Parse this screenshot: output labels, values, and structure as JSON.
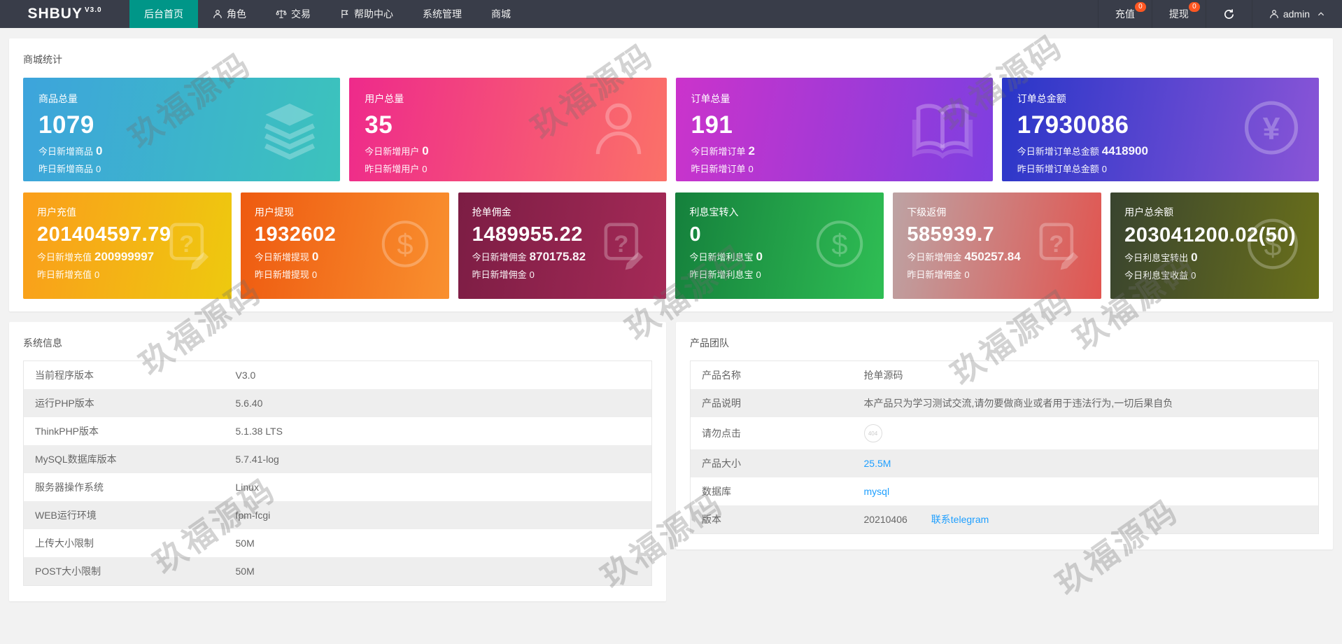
{
  "navbar": {
    "logo": "SHBUY",
    "version": "V3.0",
    "menu": [
      {
        "label": "后台首页",
        "active": true
      },
      {
        "label": "角色",
        "icon": "user-icon"
      },
      {
        "label": "交易",
        "icon": "scales-icon"
      },
      {
        "label": "帮助中心",
        "icon": "flag-icon"
      },
      {
        "label": "系统管理"
      },
      {
        "label": "商城"
      }
    ],
    "recharge": {
      "label": "充值",
      "badge": "0"
    },
    "withdraw": {
      "label": "提现",
      "badge": "0"
    },
    "user": {
      "name": "admin"
    }
  },
  "stats": {
    "title": "商城统计",
    "row1": [
      {
        "title": "商品总量",
        "value": "1079",
        "line1_label": "今日新增商品",
        "line1_value": "0",
        "line2_label": "昨日新增商品",
        "line2_value": "0",
        "icon": "layers-icon",
        "colors": [
          "#3da4dc",
          "#3cc3bc"
        ]
      },
      {
        "title": "用户总量",
        "value": "35",
        "line1_label": "今日新增用户",
        "line1_value": "0",
        "line2_label": "昨日新增用户",
        "line2_value": "0",
        "icon": "person-icon",
        "colors": [
          "#ee2a8b",
          "#fb7168"
        ]
      },
      {
        "title": "订单总量",
        "value": "191",
        "line1_label": "今日新增订单",
        "line1_value": "2",
        "line2_label": "昨日新增订单",
        "line2_value": "0",
        "icon": "book-icon",
        "colors": [
          "#cb33cb",
          "#7e3fe0"
        ]
      },
      {
        "title": "订单总金额",
        "value": "17930086",
        "line1_label": "今日新增订单总金额",
        "line1_value": "4418900",
        "line2_label": "昨日新增订单总金额",
        "line2_value": "0",
        "icon": "yen-circle-icon",
        "colors": [
          "#2936c8",
          "#8a55d7"
        ]
      }
    ],
    "row2": [
      {
        "title": "用户充值",
        "value": "201404597.79",
        "line1_label": "今日新增充值",
        "line1_value": "200999997",
        "line2_label": "昨日新增充值",
        "line2_value": "0",
        "icon": "edit-question-icon",
        "colors": [
          "#fa9e1b",
          "#eec90f"
        ]
      },
      {
        "title": "用户提现",
        "value": "1932602",
        "line1_label": "今日新增提现",
        "line1_value": "0",
        "line2_label": "昨日新增提现",
        "line2_value": "0",
        "icon": "dollar-circle-icon",
        "colors": [
          "#ee5a10",
          "#f9902f"
        ]
      },
      {
        "title": "抢单佣金",
        "value": "1489955.22",
        "line1_label": "今日新增佣金",
        "line1_value": "870175.82",
        "line2_label": "昨日新增佣金",
        "line2_value": "0",
        "icon": "edit-question-icon",
        "colors": [
          "#7c1d44",
          "#a52a57"
        ]
      },
      {
        "title": "利息宝转入",
        "value": "0",
        "line1_label": "今日新增利息宝",
        "line1_value": "0",
        "line2_label": "昨日新增利息宝",
        "line2_value": "0",
        "icon": "dollar-circle-icon",
        "colors": [
          "#15803c",
          "#2fbe54"
        ]
      },
      {
        "title": "下级返佣",
        "value": "585939.7",
        "line1_label": "今日新增佣金",
        "line1_value": "450257.84",
        "line2_label": "昨日新增佣金",
        "line2_value": "0",
        "icon": "edit-question-icon",
        "colors": [
          "#bda3a4",
          "#e15550"
        ]
      },
      {
        "title": "用户总余额",
        "value": "203041200.02(50)",
        "line1_label": "今日利息宝转出",
        "line1_value": "0",
        "line2_label": "今日利息宝收益",
        "line2_value": "0",
        "icon": "dollar-circle-icon",
        "colors": [
          "#39442f",
          "#6a701a"
        ]
      }
    ]
  },
  "system_info": {
    "title": "系统信息",
    "rows": [
      {
        "label": "当前程序版本",
        "value": "V3.0"
      },
      {
        "label": "运行PHP版本",
        "value": "5.6.40"
      },
      {
        "label": "ThinkPHP版本",
        "value": "5.1.38 LTS"
      },
      {
        "label": "MySQL数据库版本",
        "value": "5.7.41-log"
      },
      {
        "label": "服务器操作系统",
        "value": "Linux"
      },
      {
        "label": "WEB运行环境",
        "value": "fpm-fcgi"
      },
      {
        "label": "上传大小限制",
        "value": "50M"
      },
      {
        "label": "POST大小限制",
        "value": "50M"
      }
    ]
  },
  "product_team": {
    "title": "产品团队",
    "rows": [
      {
        "label": "产品名称",
        "value": "抢单源码"
      },
      {
        "label": "产品说明",
        "value": "本产品只为学习测试交流,请勿要做商业或者用于违法行为,一切后果自负"
      },
      {
        "label": "请勿点击",
        "badge": "404"
      },
      {
        "label": "产品大小",
        "link": "25.5M"
      },
      {
        "label": "数据库",
        "link": "mysql"
      },
      {
        "label": "版本",
        "value": "20210406",
        "link": "联系telegram"
      }
    ]
  },
  "watermark": "玖福源码",
  "colors": {
    "navbar_bg": "#393D49",
    "navbar_active": "#009688",
    "badge": "#FF5722",
    "link": "#1E9FFF",
    "page_bg": "#f2f2f2",
    "stripe": "#eeeeee"
  }
}
